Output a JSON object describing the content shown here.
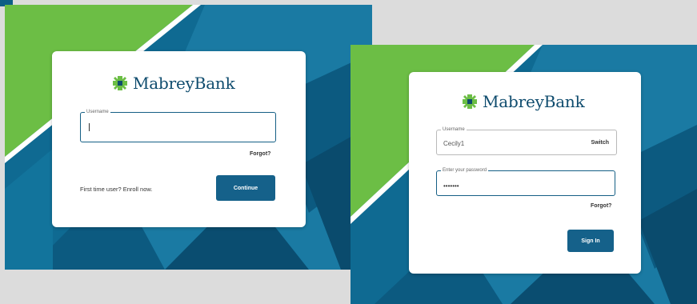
{
  "colors": {
    "green": "#6cbe45",
    "blue_dark": "#0d4f75",
    "blue_mid": "#14698f",
    "button": "#15618a"
  },
  "brand": {
    "logo_icon": "flower-cross-logo-icon",
    "name": "MabreyBank"
  },
  "screen1": {
    "username_label": "Username",
    "username_value": "",
    "forgot": "Forgot?",
    "enroll": "First time user? Enroll now.",
    "continue": "Continue"
  },
  "screen2": {
    "username_label": "Username",
    "username_value": "Cecily1",
    "switch": "Switch",
    "password_label": "Enter your password",
    "password_value": "•••••••",
    "forgot": "Forgot?",
    "signin": "Sign In"
  }
}
